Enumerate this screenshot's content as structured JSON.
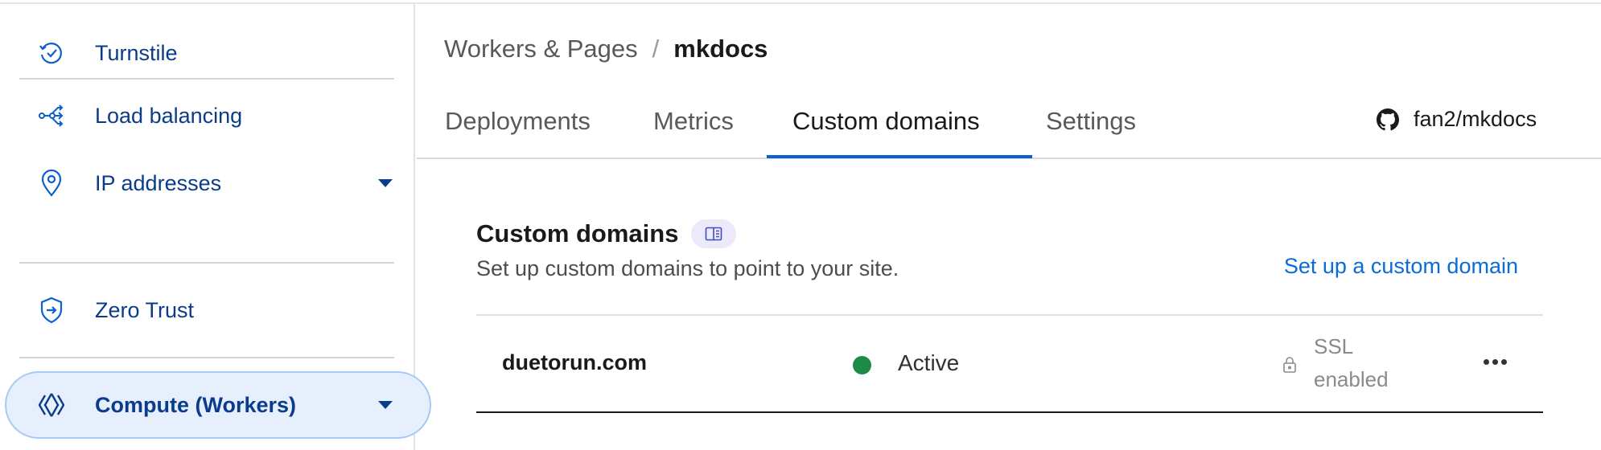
{
  "sidebar": {
    "items": [
      {
        "label": "Turnstile",
        "icon": "turnstile-icon",
        "has_caret": false
      },
      {
        "label": "Load balancing",
        "icon": "load-balancing-icon",
        "has_caret": false
      },
      {
        "label": "IP addresses",
        "icon": "location-pin-icon",
        "has_caret": true
      },
      {
        "label": "Zero Trust",
        "icon": "shield-icon",
        "has_caret": false
      },
      {
        "label": "Compute (Workers)",
        "icon": "workers-icon",
        "has_caret": true,
        "active": true
      }
    ]
  },
  "breadcrumb": {
    "parent": "Workers & Pages",
    "separator": "/",
    "current": "mkdocs"
  },
  "tabs": [
    {
      "label": "Deployments",
      "active": false
    },
    {
      "label": "Metrics",
      "active": false
    },
    {
      "label": "Custom domains",
      "active": true
    },
    {
      "label": "Settings",
      "active": false
    }
  ],
  "repo": {
    "icon": "github-icon",
    "name": "fan2/mkdocs"
  },
  "section": {
    "title": "Custom domains",
    "badge_icon": "docs-book-icon",
    "subtitle": "Set up custom domains to point to your site.",
    "action_label": "Set up a custom domain"
  },
  "domains": [
    {
      "domain": "duetorun.com",
      "status": "Active",
      "status_color": "#1e8a48",
      "ssl_line1": "SSL",
      "ssl_line2": "enabled"
    }
  ],
  "colors": {
    "accent": "#0b5fd1",
    "link": "#0b6bd8",
    "nav_text": "#0b3c8c",
    "active_bg": "#e6f0fc"
  }
}
